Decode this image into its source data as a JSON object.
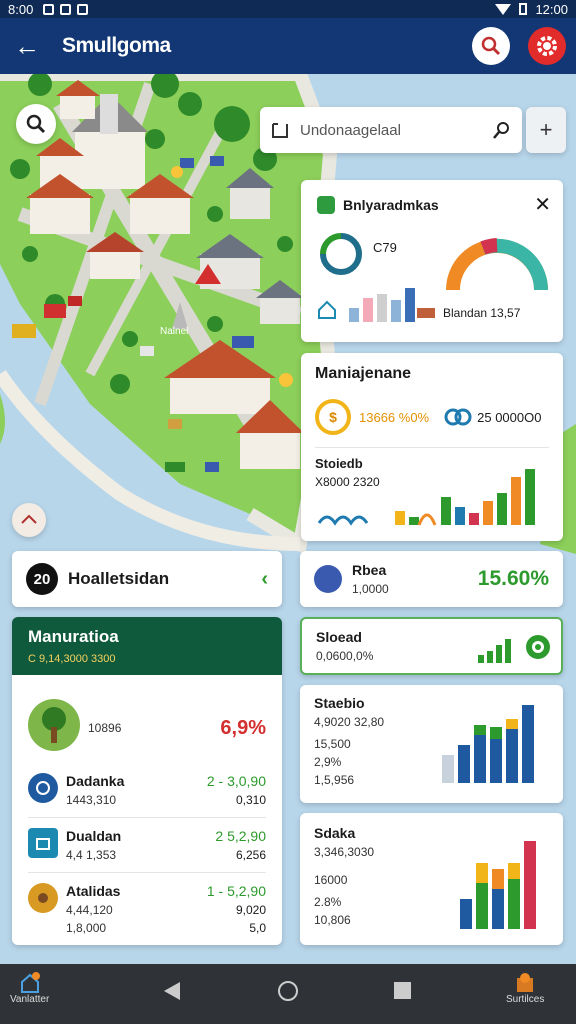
{
  "status": {
    "time_left": "8:00",
    "time_right": "12:00"
  },
  "appbar": {
    "title": "Smullgoma"
  },
  "map": {
    "search_placeholder": "Undonaagelaal",
    "place_label": "Nalnel"
  },
  "popup": {
    "title": "Bnlyaradmkas",
    "gauge_value": "C79",
    "meter_label": "Blandan 13,57"
  },
  "management": {
    "title": "Maniajenane",
    "stat1": "13666 %0%",
    "stat2": "25 0000O0",
    "sub_title": "Stoiedb",
    "sub_value": "X8000 2320"
  },
  "location_card": {
    "number": "20",
    "name": "Hoalletsidan"
  },
  "panel": {
    "title": "Manuratioa",
    "subtitle": "C 9,14,3000   3300",
    "items": [
      {
        "name": "",
        "sub": "10896",
        "value": "6,9%",
        "icon": "tree-icon"
      },
      {
        "name": "Dadanka",
        "sub": "1443,310",
        "value1": "2 - 3,0,90",
        "value2": "0,310",
        "icon": "globe-icon"
      },
      {
        "name": "Dualdan",
        "sub": "4,4 1,353",
        "value1": "2  5,2,90",
        "value2": "6,256",
        "icon": "briefcase-icon"
      },
      {
        "name": "Atalidas",
        "sub": "4,44,120",
        "value1": "1 - 5,2,90",
        "value2": "9,020",
        "extra1": "1,8,000",
        "extra2": "5,0",
        "icon": "coin-icon"
      }
    ]
  },
  "right_cards": {
    "rate": {
      "label": "Rbea",
      "value": "1,0000",
      "percent": "15.60%"
    },
    "speed": {
      "label": "Sloead",
      "value": "0,0600,0%"
    },
    "stats": {
      "label": "Staebio",
      "v1": "4,9020 32,80",
      "v2": "15,500",
      "v3": "2,9%",
      "v4": "1,5,956"
    },
    "stocks": {
      "label": "Sdaka",
      "v1": "3,346,3030",
      "v2": "16000",
      "v3": "2.8%",
      "v4": "10,806"
    }
  },
  "bottom": {
    "left_label": "Vanlatter",
    "right_label": "Surtilces"
  },
  "colors": {
    "appbar": "#123774",
    "panel_head": "#0f5a3c",
    "accent_green": "#2c9a2c",
    "accent_red": "#d42f2f"
  }
}
